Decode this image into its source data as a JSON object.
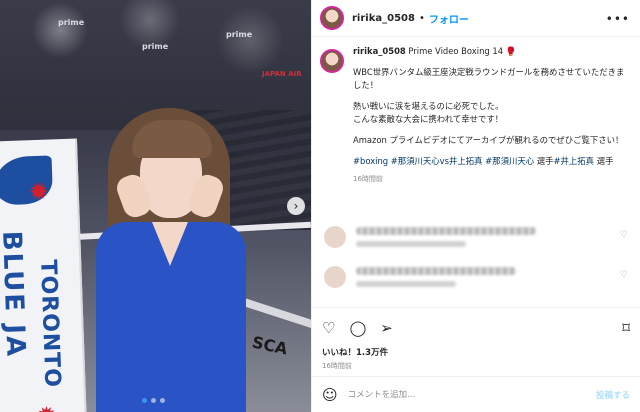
{
  "post": {
    "username": "ririka_0508",
    "separator": "•",
    "follow_label": "フォロー",
    "more_label": "•••",
    "caption_title": "Prime Video Boxing 14",
    "caption_title_emoji": "🥊",
    "caption_paragraph_1": "WBC世界バンタム級王座決定戦ラウンドガールを務めさせていただきました！",
    "caption_paragraph_2_line_1": "熱い戦いに涙を堪えるのに必死でした。",
    "caption_paragraph_2_line_2": "こんな素敵な大会に携われて幸せです！",
    "caption_paragraph_3": "Amazon プライムビデオにてアーカイブが観れるのでぜひご覧下さい！",
    "hashtags": [
      "#boxing",
      "#那須川天心vs井上拓真",
      "#那須川天心",
      "選手",
      "#井上拓真",
      "選手"
    ],
    "caption_time": "16時間前",
    "likes": "いいね！1.3万件",
    "posted_time": "16時間前"
  },
  "photo": {
    "banner_text_1": "TORONTO",
    "banner_text_2": "BLUE JA",
    "ring_text": "SCA",
    "prime_labels": [
      "prime",
      "prime",
      "prime"
    ],
    "sponsor_label": "JAPAN AIR",
    "next_icon": "chevron-right-icon",
    "carousel_dots": 3,
    "carousel_active_index": 1
  },
  "comment_input": {
    "placeholder": "コメントを追加...",
    "post_label": "投稿する"
  },
  "icons": {
    "heart": "♡",
    "comment": "◯",
    "share": "➢",
    "save": "⌑",
    "emoji": "☺",
    "next": "›"
  },
  "colors": {
    "link": "#00376b",
    "follow": "#0095f6",
    "post_disabled": "#b2dffc",
    "dress": "#2a53c6"
  }
}
